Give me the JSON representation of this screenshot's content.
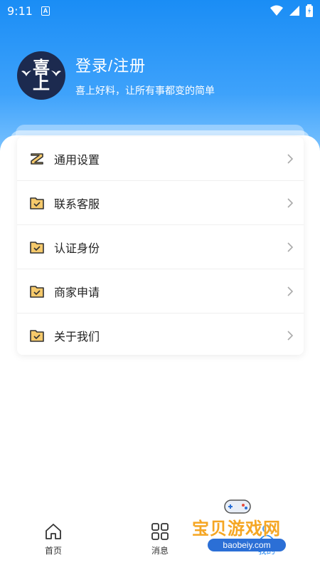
{
  "status_bar": {
    "time": "9:11",
    "notification_glyph": "A"
  },
  "profile": {
    "avatar_line1": "喜",
    "avatar_line2": "上",
    "title": "登录/注册",
    "subtitle": "喜上好料，让所有事都变的简单"
  },
  "menu": {
    "items": [
      {
        "label": "通用设置",
        "icon": "settings-z-icon"
      },
      {
        "label": "联系客服",
        "icon": "folder-check-icon"
      },
      {
        "label": "认证身份",
        "icon": "folder-check-icon"
      },
      {
        "label": "商家申请",
        "icon": "folder-check-icon"
      },
      {
        "label": "关于我们",
        "icon": "folder-check-icon"
      }
    ]
  },
  "tabbar": {
    "items": [
      {
        "label": "首页",
        "icon": "home-icon"
      },
      {
        "label": "消息",
        "icon": "grid-icon"
      },
      {
        "label": "我的",
        "icon": "user-icon"
      }
    ]
  },
  "watermark": {
    "text": "宝贝游戏网",
    "url": "baobeiy.com"
  },
  "colors": {
    "header_top": "#1a8df5",
    "header_bottom": "#8fcdff",
    "accent": "#2b8bf2",
    "icon_fill": "#f5c96b"
  }
}
